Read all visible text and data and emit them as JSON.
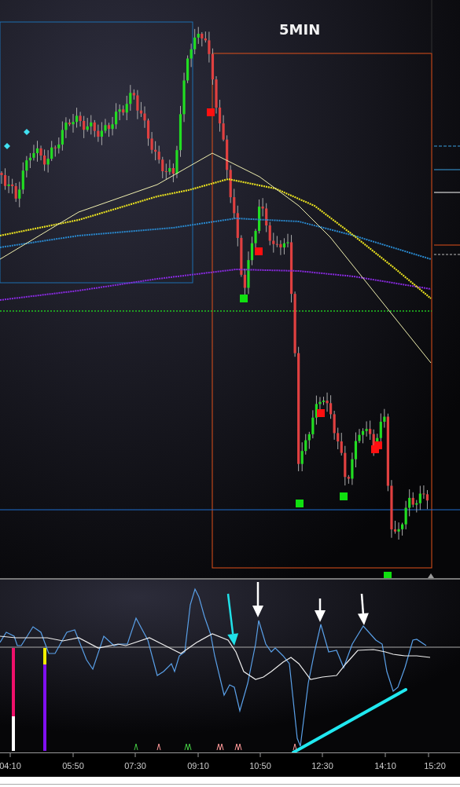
{
  "chart": {
    "title": "5MIN"
  },
  "time_axis": {
    "labels": [
      "04:10",
      "05:50",
      "07:30",
      "09:10",
      "10:50",
      "12:30",
      "14:10",
      "15:20"
    ]
  }
}
